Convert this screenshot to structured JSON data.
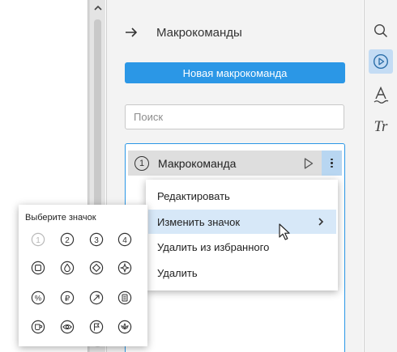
{
  "panel": {
    "title": "Макрокоманды",
    "new_button_label": "Новая макрокоманда",
    "search_placeholder": "Поиск"
  },
  "macros": [
    {
      "number": "1",
      "name": "Макрокоманда"
    }
  ],
  "context_menu": {
    "items": [
      {
        "label": "Редактировать"
      },
      {
        "label": "Изменить значок"
      },
      {
        "label": "Удалить из избранного"
      },
      {
        "label": "Удалить"
      }
    ]
  },
  "icon_picker": {
    "title": "Выберите значок",
    "icons": [
      {
        "name": "number-1-icon",
        "glyph": "1"
      },
      {
        "name": "number-2-icon",
        "glyph": "2"
      },
      {
        "name": "number-3-icon",
        "glyph": "3"
      },
      {
        "name": "number-4-icon",
        "glyph": "4"
      },
      {
        "name": "square-icon"
      },
      {
        "name": "drop-icon"
      },
      {
        "name": "diamond-icon"
      },
      {
        "name": "compass-icon"
      },
      {
        "name": "percent-icon",
        "glyph": "%"
      },
      {
        "name": "ruble-icon",
        "glyph": "₽"
      },
      {
        "name": "arrow-up-right-icon"
      },
      {
        "name": "document-icon"
      },
      {
        "name": "cup-icon"
      },
      {
        "name": "eye-icon"
      },
      {
        "name": "flag-icon"
      },
      {
        "name": "lotus-icon"
      }
    ]
  },
  "toolbar": {
    "buttons": [
      {
        "name": "search-icon"
      },
      {
        "name": "macro-play-icon",
        "active": true
      },
      {
        "name": "text-style-icon"
      },
      {
        "name": "font-icon",
        "glyph": "Tr"
      }
    ]
  },
  "colors": {
    "accent": "#2b97e6",
    "hover": "#d7e8f8",
    "active_toolbar": "#c4dcf4"
  }
}
